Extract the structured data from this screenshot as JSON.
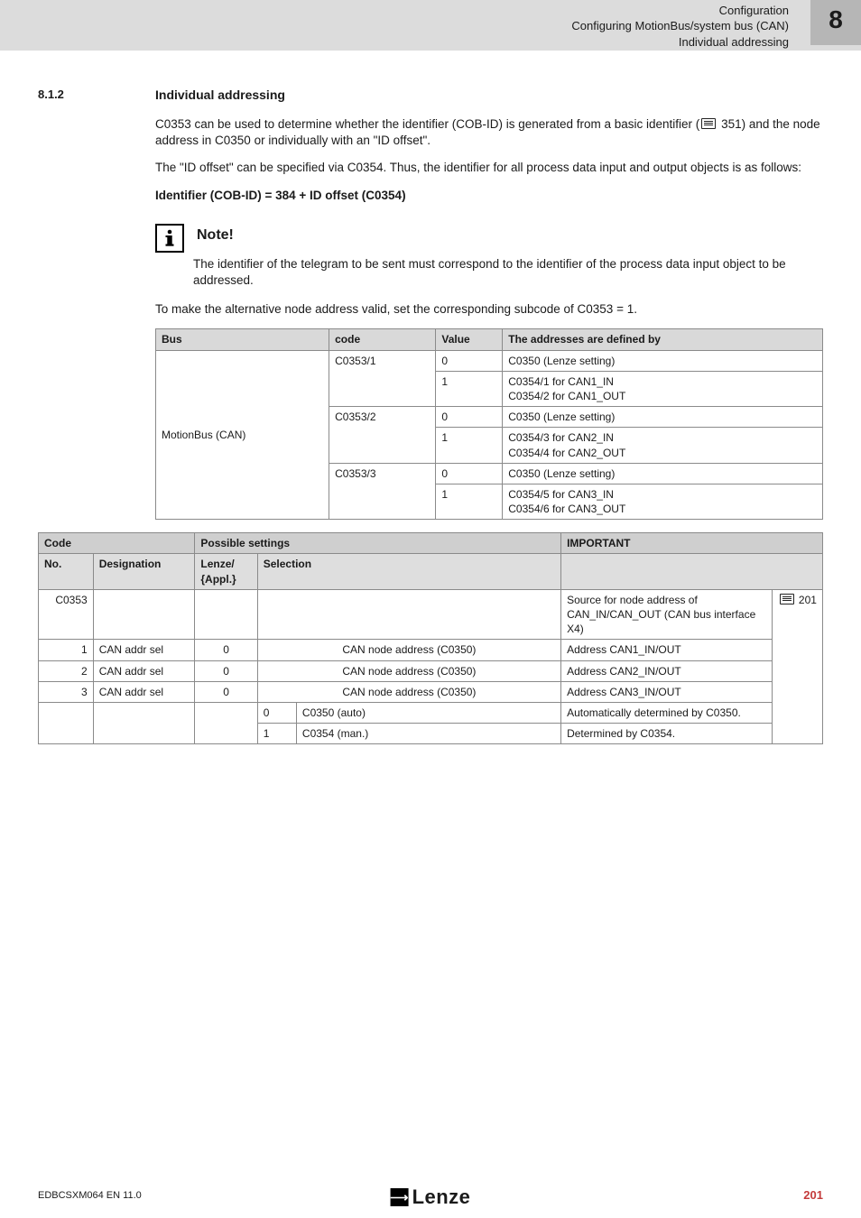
{
  "header": {
    "config_title": "Configuration",
    "subtitle1": "Configuring MotionBus/system bus (CAN)",
    "subtitle2": "Individual addressing",
    "chapter_no": "8"
  },
  "section": {
    "num": "8.1.2",
    "title": "Individual addressing"
  },
  "para1_a": "C0353 can be used to determine whether the identifier (COB-ID) is generated from a basic identifier (",
  "para1_ref": " 351) and the node address in C0350 or individually with an \"ID offset\".",
  "para2": "The \"ID offset\" can be specified via C0354. Thus, the identifier for all process data input and output objects is as follows:",
  "para3": "Identifier (COB-ID) = 384 + ID offset (C0354)",
  "note": {
    "head": "Note!",
    "body": "The identifier of the telegram to be sent must correspond to the identifier of the process data input object to be addressed."
  },
  "para4": "To make the alternative node address valid, set the corresponding subcode of C0353 = 1.",
  "bus_table": {
    "head": [
      "Bus",
      "code",
      "Value",
      "The addresses are defined by"
    ],
    "bus_label": "MotionBus (CAN)",
    "rows": [
      {
        "code": "C0353/1",
        "value": "0",
        "def": "C0350 (Lenze setting)"
      },
      {
        "code": "",
        "value": "1",
        "def": "C0354/1 for CAN1_IN\nC0354/2 for CAN1_OUT"
      },
      {
        "code": "C0353/2",
        "value": "0",
        "def": "C0350 (Lenze setting)"
      },
      {
        "code": "",
        "value": "1",
        "def": "C0354/3 for CAN2_IN\nC0354/4 for CAN2_OUT"
      },
      {
        "code": "C0353/3",
        "value": "0",
        "def": "C0350 (Lenze setting)"
      },
      {
        "code": "",
        "value": "1",
        "def": "C0354/5 for CAN3_IN\nC0354/6 for CAN3_OUT"
      }
    ]
  },
  "code_table": {
    "head1": [
      "Code",
      "Possible settings",
      "IMPORTANT"
    ],
    "head2": [
      "No.",
      "Designation",
      "Lenze/\n{Appl.}",
      "Selection"
    ],
    "rows": [
      {
        "no": "C0353",
        "desig": "",
        "lenze": "",
        "sel_a": "",
        "sel_b": "",
        "important": "Source for node address of CAN_IN/CAN_OUT (CAN bus interface X4)",
        "page": " 201"
      },
      {
        "no": "1",
        "desig": "CAN addr sel",
        "lenze": "0",
        "sel_a": "",
        "sel_b": "CAN node address (C0350)",
        "important": "Address CAN1_IN/OUT"
      },
      {
        "no": "2",
        "desig": "CAN addr sel",
        "lenze": "0",
        "sel_a": "",
        "sel_b": "CAN node address (C0350)",
        "important": "Address CAN2_IN/OUT"
      },
      {
        "no": "3",
        "desig": "CAN addr sel",
        "lenze": "0",
        "sel_a": "",
        "sel_b": "CAN node address (C0350)",
        "important": "Address CAN3_IN/OUT"
      },
      {
        "no": "",
        "desig": "",
        "lenze": "",
        "sel_a": "0",
        "sel_b": "C0350 (auto)",
        "important": "Automatically determined by C0350."
      },
      {
        "no": "",
        "desig": "",
        "lenze": "",
        "sel_a": "1",
        "sel_b": "C0354 (man.)",
        "important": "Determined by C0354."
      }
    ]
  },
  "footer": {
    "doc": "EDBCSXM064 EN 11.0",
    "page": "201",
    "brand": "Lenze"
  }
}
